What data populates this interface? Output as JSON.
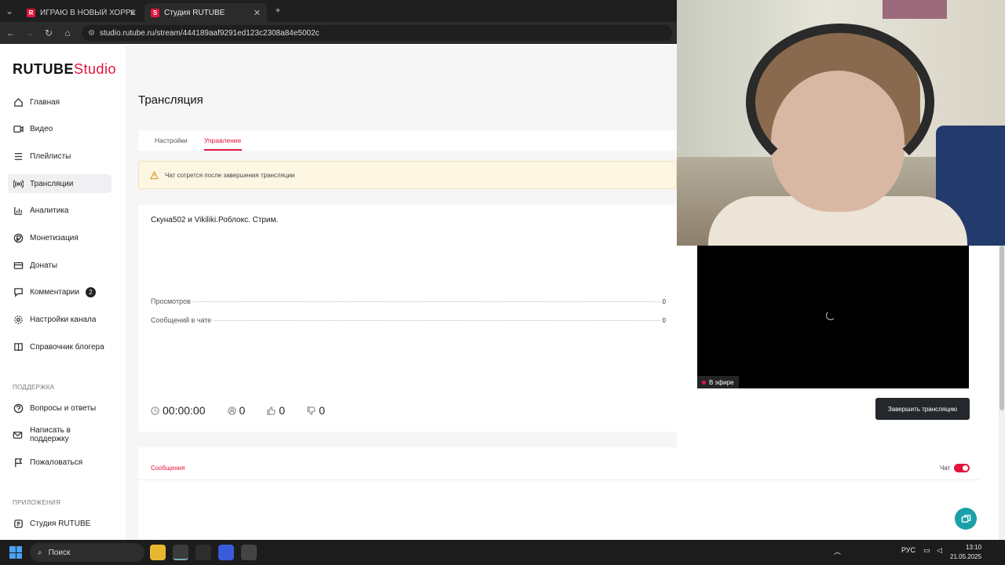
{
  "browser": {
    "tabs": [
      {
        "label": "ИГРАЮ В НОВЫЙ ХОРРОР РО",
        "favicon": "R",
        "active": false
      },
      {
        "label": "Студия RUTUBE",
        "favicon": "S",
        "active": true
      }
    ],
    "url": "studio.rutube.ru/stream/444189aaf9291ed123c2308a84e5002c"
  },
  "logo": {
    "brand": "RUTUBE",
    "suffix": "Studio"
  },
  "sidebar": {
    "items": [
      {
        "label": "Главная",
        "icon": "home-icon"
      },
      {
        "label": "Видео",
        "icon": "video-icon"
      },
      {
        "label": "Плейлисты",
        "icon": "playlist-icon"
      },
      {
        "label": "Трансляции",
        "icon": "broadcast-icon"
      },
      {
        "label": "Аналитика",
        "icon": "analytics-icon"
      },
      {
        "label": "Монетизация",
        "icon": "money-icon"
      },
      {
        "label": "Донаты",
        "icon": "donate-icon"
      },
      {
        "label": "Комментарии",
        "icon": "comment-icon",
        "badge": "2"
      },
      {
        "label": "Настройки канала",
        "icon": "gear-icon"
      },
      {
        "label": "Справочник блогера",
        "icon": "book-icon"
      }
    ],
    "support_label": "ПОДДЕРЖКА",
    "support_items": [
      {
        "label": "Вопросы и ответы",
        "icon": "question-icon"
      },
      {
        "label": "Написать в поддержку",
        "icon": "mail-icon"
      },
      {
        "label": "Пожаловаться",
        "icon": "flag-icon"
      }
    ],
    "apps_label": "ПРИЛОЖЕНИЯ",
    "apps_items": [
      {
        "label": "Студия RUTUBE",
        "icon": "studio-icon"
      }
    ]
  },
  "main": {
    "title": "Трансляция",
    "tabs": [
      "Настройки",
      "Управление"
    ],
    "warning": "Чат сотрется после завершения трансляции",
    "stream_title": "Скуна502 и Vikiliki.Роблокс. Стрим.",
    "stats": [
      {
        "label": "Просмотров",
        "value": "0"
      },
      {
        "label": "Сообщений в чате",
        "value": "0"
      }
    ],
    "counters": {
      "duration": "00:00:00",
      "viewers": "0",
      "likes": "0",
      "dislikes": "0"
    },
    "live_label": "В эфире",
    "end_button": "Завершить трансляцию",
    "messages_tab": "Сообщения",
    "chat_toggle_label": "Чат",
    "chat_enabled": true
  },
  "taskbar": {
    "search_placeholder": "Поиск",
    "language": "РУС",
    "time": "13:10",
    "date": "21.05.2025"
  },
  "colors": {
    "accent": "#e4143c",
    "warning_bg": "#fdf6e3",
    "dark_button": "#24272c",
    "help_button": "#1aa0a8"
  }
}
